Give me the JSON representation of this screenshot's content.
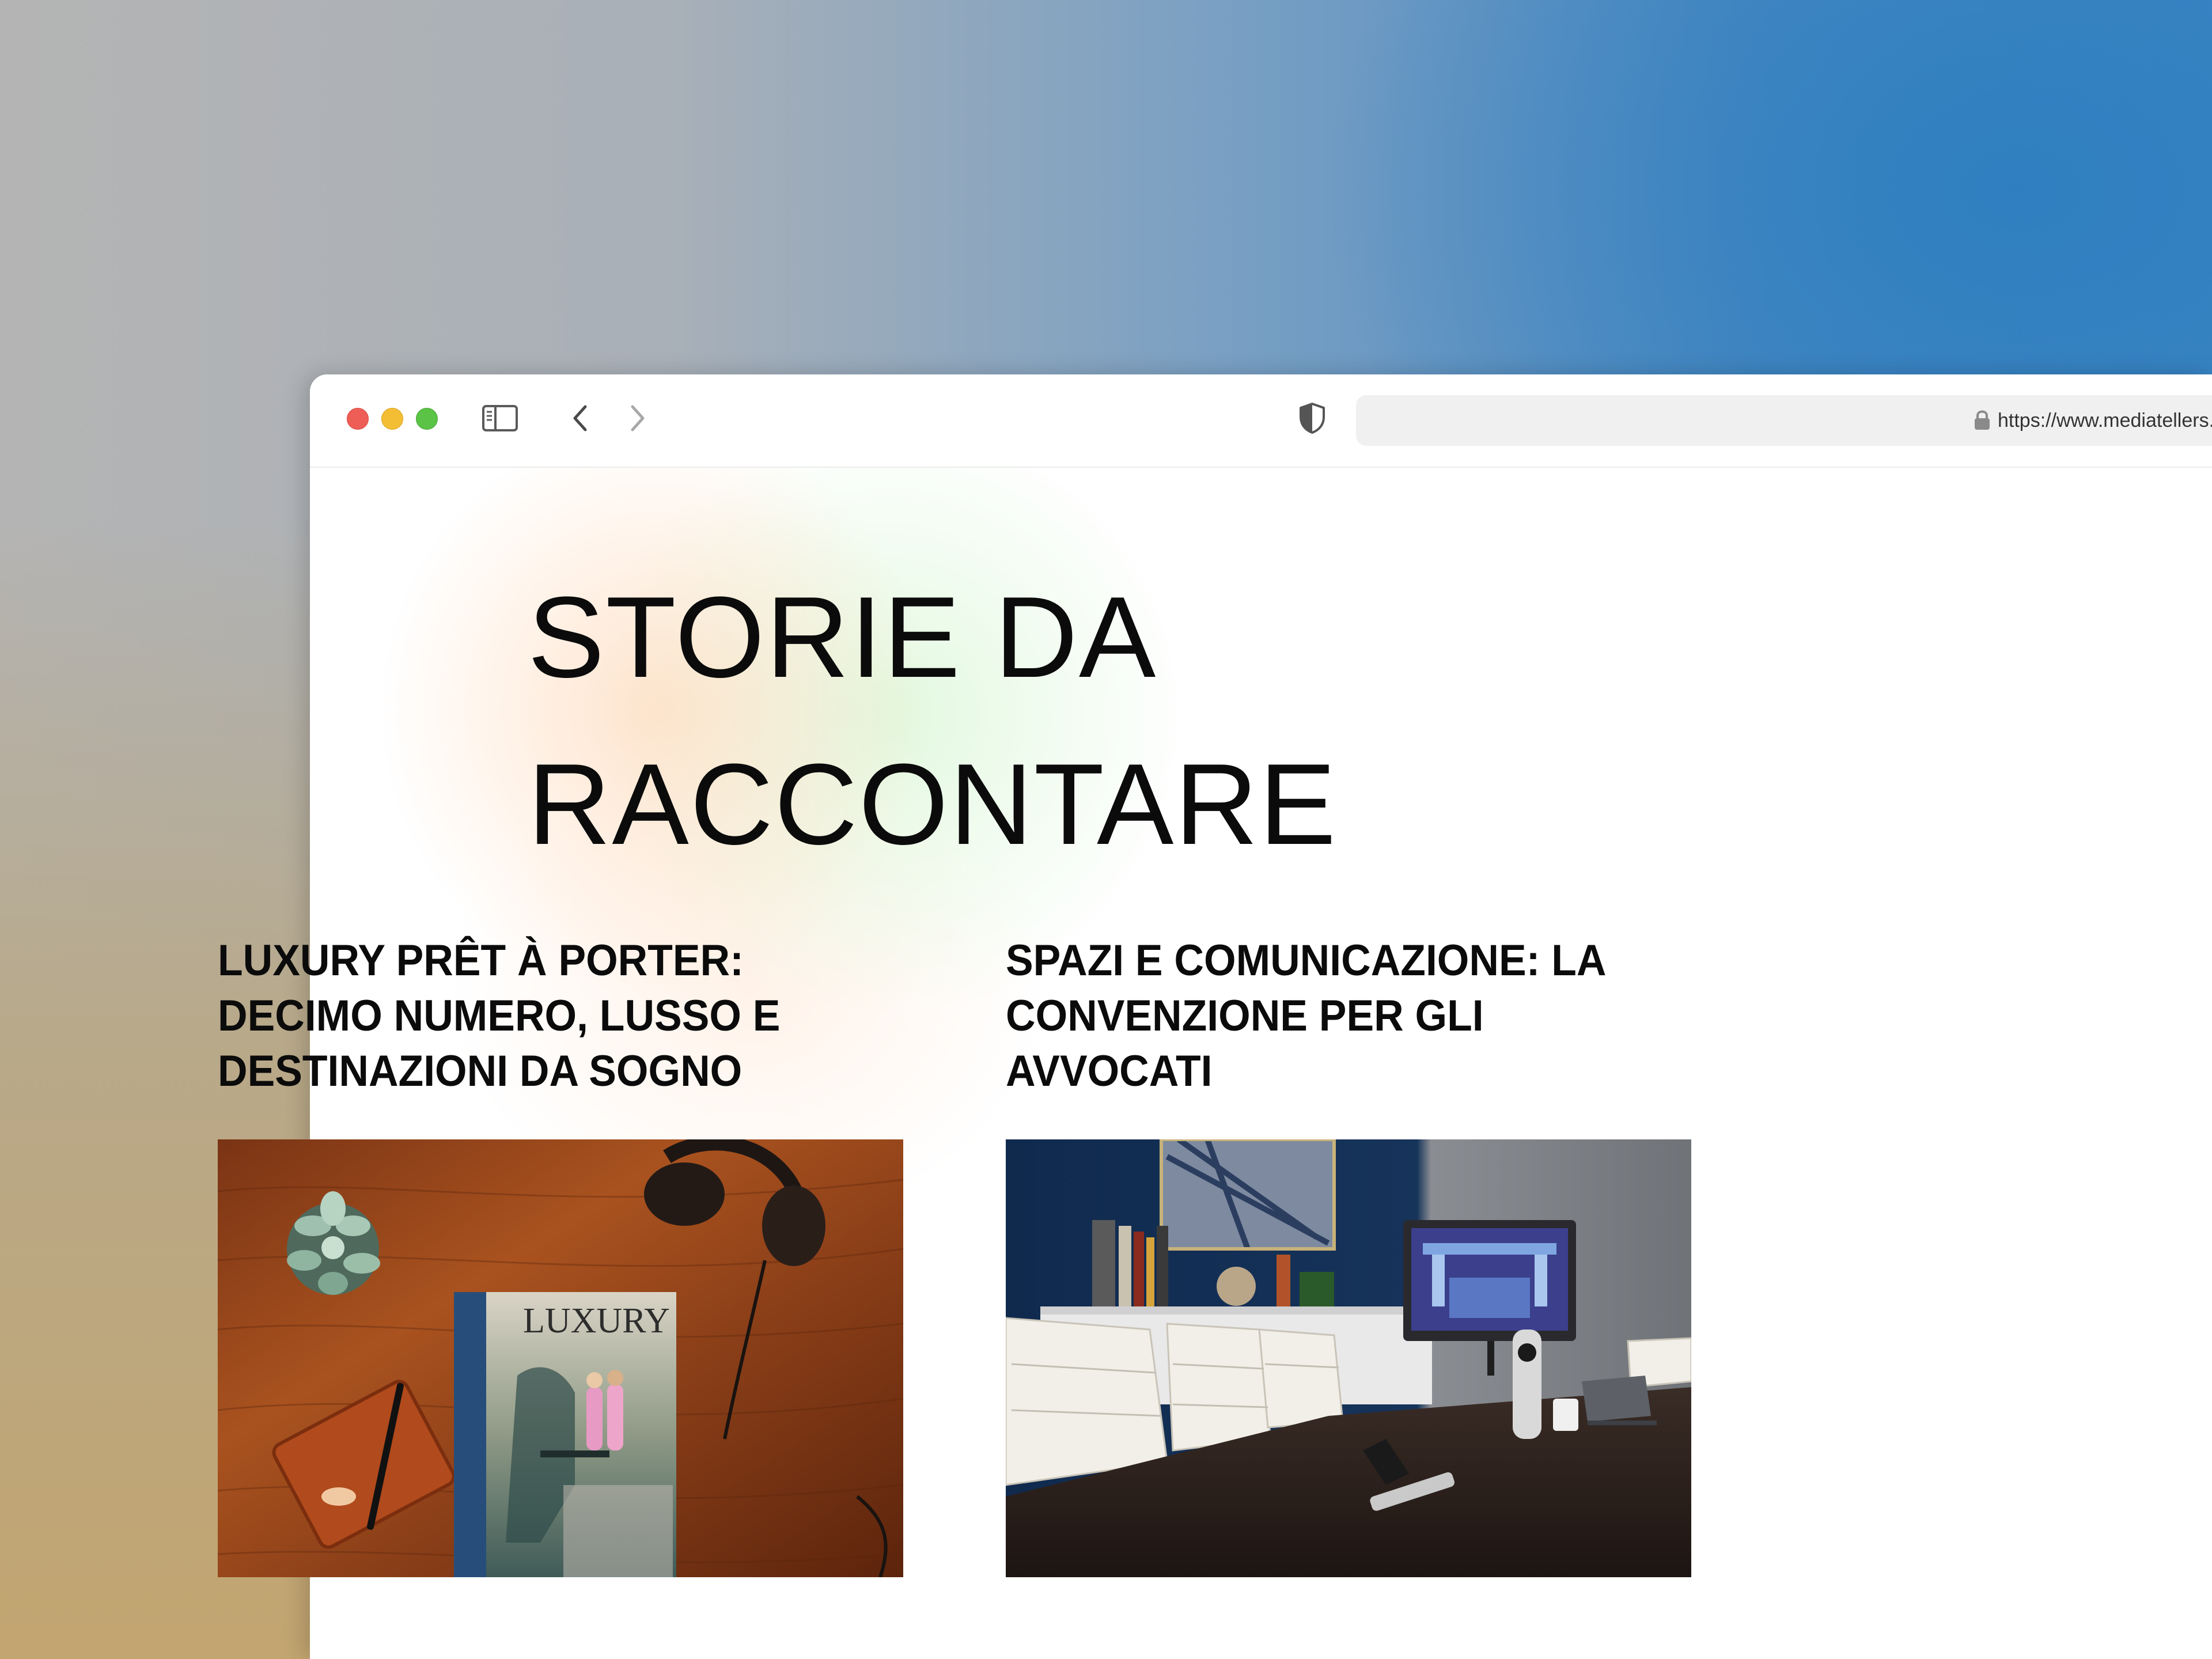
{
  "browser": {
    "url": "https://www.mediatellers.it/",
    "toolbar": {
      "icons": [
        "close-dot",
        "minimize-dot",
        "zoom-dot",
        "sidebar-icon",
        "chevron-left-icon",
        "chevron-right-icon",
        "privacy-shield-icon",
        "lock-icon"
      ]
    }
  },
  "page": {
    "hero_title": [
      "STORIE DA",
      "RACCONTARE"
    ],
    "articles": [
      {
        "title": [
          "LUXURY PRÊT À PORTER:",
          "DECIMO NUMERO, LUSSO E",
          "DESTINAZIONI DA SOGNO"
        ],
        "image": "magazine-on-wooden-desk",
        "magazine_logo": "LUXURY"
      },
      {
        "title": [
          "SPAZI E COMUNICAZIONE: LA",
          "CONVENZIONE PER GLI",
          "AVVOCATI"
        ],
        "image": "conference-room"
      }
    ]
  },
  "colors": {
    "traffic_red": "#ee5e56",
    "traffic_yellow": "#f3bd34",
    "traffic_green": "#5bc346",
    "text": "#0b0b0b",
    "address_bar": "#f0f0f1"
  }
}
